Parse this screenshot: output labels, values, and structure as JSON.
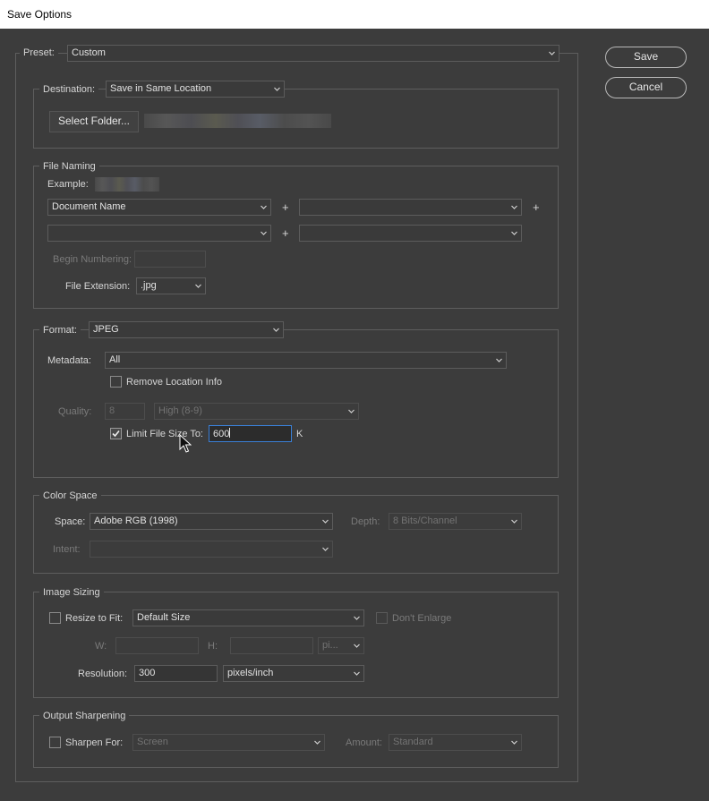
{
  "window": {
    "title": "Save Options"
  },
  "buttons": {
    "save": "Save",
    "cancel": "Cancel"
  },
  "preset": {
    "label": "Preset:",
    "value": "Custom"
  },
  "destination": {
    "label": "Destination:",
    "value": "Save in Same Location",
    "select_folder": "Select Folder..."
  },
  "file_naming": {
    "legend": "File Naming",
    "example_label": "Example:",
    "field1": "Document Name",
    "field2": "",
    "field3": "",
    "field4": "",
    "plus": "+",
    "begin_numbering_label": "Begin Numbering:",
    "begin_numbering_value": "",
    "extension_label": "File Extension:",
    "extension_value": ".jpg"
  },
  "format": {
    "label": "Format:",
    "value": "JPEG",
    "metadata_label": "Metadata:",
    "metadata_value": "All",
    "remove_location_label": "Remove Location Info",
    "remove_location_checked": false,
    "quality_label": "Quality:",
    "quality_value": "8",
    "quality_preset": "High  (8-9)",
    "limit_label": "Limit File Size To:",
    "limit_checked": true,
    "limit_value": "600",
    "limit_unit": "K"
  },
  "color_space": {
    "legend": "Color Space",
    "space_label": "Space:",
    "space_value": "Adobe RGB (1998)",
    "depth_label": "Depth:",
    "depth_value": "8 Bits/Channel",
    "intent_label": "Intent:",
    "intent_value": ""
  },
  "image_sizing": {
    "legend": "Image Sizing",
    "resize_label": "Resize to Fit:",
    "resize_checked": false,
    "resize_value": "Default Size",
    "dont_enlarge_label": "Don't Enlarge",
    "dont_enlarge_checked": false,
    "w_label": "W:",
    "w_value": "",
    "h_label": "H:",
    "h_value": "",
    "unit_value": "pi...",
    "resolution_label": "Resolution:",
    "resolution_value": "300",
    "resolution_unit": "pixels/inch"
  },
  "output_sharpening": {
    "legend": "Output Sharpening",
    "sharpen_label": "Sharpen For:",
    "sharpen_checked": false,
    "sharpen_value": "Screen",
    "amount_label": "Amount:",
    "amount_value": "Standard"
  },
  "icons": {
    "chevron": "chevron-down-icon",
    "check": "checkmark-icon",
    "cursor": "mouse-pointer-icon"
  }
}
